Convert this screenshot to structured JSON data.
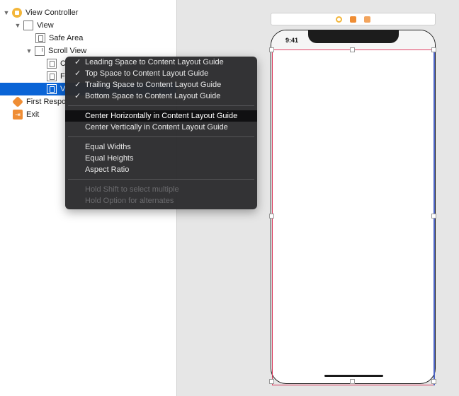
{
  "outline": {
    "items": [
      {
        "label": "View Controller",
        "icon": "view-controller-icon"
      },
      {
        "label": "View",
        "icon": "view-icon"
      },
      {
        "label": "Safe Area",
        "icon": "safe-area-icon"
      },
      {
        "label": "Scroll View",
        "icon": "scroll-view-icon"
      },
      {
        "label": "C",
        "icon": "view-icon"
      },
      {
        "label": "F",
        "icon": "view-icon"
      },
      {
        "label": "V",
        "icon": "view-icon"
      },
      {
        "label": "First Respo",
        "icon": "first-responder-icon"
      },
      {
        "label": "Exit",
        "icon": "exit-icon"
      }
    ]
  },
  "menu": {
    "group1": [
      {
        "label": "Leading Space to Content Layout Guide",
        "checked": "✓"
      },
      {
        "label": "Top Space to Content Layout Guide",
        "checked": "✓"
      },
      {
        "label": "Trailing Space to Content Layout Guide",
        "checked": "✓"
      },
      {
        "label": "Bottom Space to Content Layout Guide",
        "checked": "✓"
      }
    ],
    "group2": [
      {
        "label": "Center Horizontally in Content Layout Guide"
      },
      {
        "label": "Center Vertically in Content Layout Guide"
      }
    ],
    "group3": [
      {
        "label": "Equal Widths"
      },
      {
        "label": "Equal Heights"
      },
      {
        "label": "Aspect Ratio"
      }
    ],
    "hints": [
      {
        "label": "Hold Shift to select multiple"
      },
      {
        "label": "Hold Option for alternates"
      }
    ]
  },
  "device": {
    "time": "9:41"
  },
  "colors": {
    "selection": "#0a64d6",
    "constraint_red": "#d9375a",
    "constraint_blue": "#4b63c4",
    "accent_orange": "#ef8d34",
    "accent_yellow": "#f3b63a"
  }
}
